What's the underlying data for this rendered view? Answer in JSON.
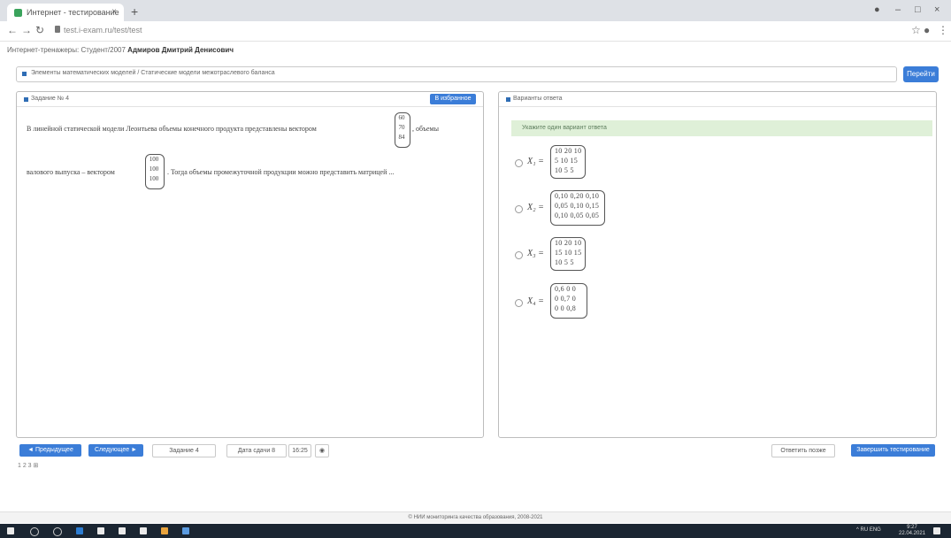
{
  "browser": {
    "tab_title": "Интернет - тестирование",
    "tab_close": "×",
    "new_tab": "+",
    "url": "test.i-exam.ru/test/test"
  },
  "header": {
    "breadcrumb_prefix": "Интернет-тренажеры: Студент/2007",
    "student_name": "Адмиров Дмитрий Денисович"
  },
  "topic": {
    "text": "Элементы математических моделей / Статические модели межотраслевого баланса",
    "go_label": "Перейти"
  },
  "task": {
    "header": "Задание № 4",
    "button": "В избранное",
    "text_part1": "В линейной статической модели Леонтьева объемы конечного продукта представлены вектором",
    "vec1": [
      "60",
      "70",
      "84"
    ],
    "text_part2": ", объемы",
    "text_part3": "валового выпуска – вектором",
    "vec2": [
      "100",
      "100",
      "100"
    ],
    "text_part4": ". Тогда объемы промежуточной продукции можно представить матрицей ..."
  },
  "answers": {
    "header": "Варианты ответа",
    "hint": "Укажите один вариант ответа",
    "options": [
      {
        "label": "X₁ =",
        "rows": [
          "10  20  10",
          "5   10  15",
          "10   5   5"
        ]
      },
      {
        "label": "X₂ =",
        "rows": [
          "0,10  0,20  0,10",
          "0,05  0,10  0,15",
          "0,10  0,05  0,05"
        ]
      },
      {
        "label": "X₃ =",
        "rows": [
          "10  20  10",
          "15  10  15",
          "10   5   5"
        ]
      },
      {
        "label": "X₄ =",
        "rows": [
          "0,6   0    0",
          "0   0,7   0",
          "0    0   0,8"
        ]
      }
    ]
  },
  "controls": {
    "prev": "◄ Предыдущее",
    "next": "Следующее ►",
    "task_count": "Задание 4",
    "time": "Дата сдачи 8",
    "clock": "16:25",
    "finish_later": "Ответить позже",
    "finish": "Завершить тестирование",
    "pager": "1 2 3 ⊞"
  },
  "footer": {
    "text": "© НИИ мониторинга качества образования, 2008-2021"
  },
  "taskbar": {
    "tray_text": "^ RU ENG",
    "time": "9:27",
    "date": "22.04.2021"
  }
}
